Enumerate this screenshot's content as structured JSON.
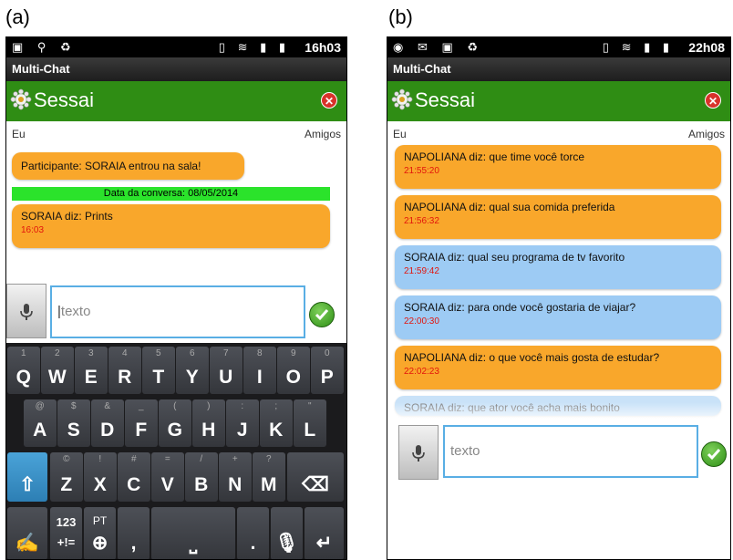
{
  "labels": {
    "a": "(a)",
    "b": "(b)"
  },
  "screen_a": {
    "status_time": "16h03",
    "app_title": "Multi-Chat",
    "brand": "Sessai",
    "col_left": "Eu",
    "col_right": "Amigos",
    "msg_join": "Participante: SORAIA entrou na sala!",
    "date_bar": "Data da conversa: 08/05/2014",
    "msg_text": "SORAIA diz: Prints",
    "msg_time": "16:03",
    "input_placeholder": "texto",
    "keyboard": {
      "row1": [
        {
          "k": "Q",
          "s": "1"
        },
        {
          "k": "W",
          "s": "2"
        },
        {
          "k": "E",
          "s": "3"
        },
        {
          "k": "R",
          "s": "4"
        },
        {
          "k": "T",
          "s": "5"
        },
        {
          "k": "Y",
          "s": "6"
        },
        {
          "k": "U",
          "s": "7"
        },
        {
          "k": "I",
          "s": "8"
        },
        {
          "k": "O",
          "s": "9"
        },
        {
          "k": "P",
          "s": "0"
        }
      ],
      "row2": [
        {
          "k": "A",
          "s": "@"
        },
        {
          "k": "S",
          "s": "$"
        },
        {
          "k": "D",
          "s": "&"
        },
        {
          "k": "F",
          "s": "_"
        },
        {
          "k": "G",
          "s": "("
        },
        {
          "k": "H",
          "s": ")"
        },
        {
          "k": "J",
          "s": ":"
        },
        {
          "k": "K",
          "s": ";"
        },
        {
          "k": "L",
          "s": "\""
        }
      ],
      "row3": [
        {
          "k": "Z",
          "s": "©"
        },
        {
          "k": "X",
          "s": "!"
        },
        {
          "k": "C",
          "s": "#"
        },
        {
          "k": "V",
          "s": "="
        },
        {
          "k": "B",
          "s": "/"
        },
        {
          "k": "N",
          "s": "+"
        },
        {
          "k": "M",
          "s": "?"
        }
      ],
      "sym_key": "123\n+!=",
      "lang_key": "PT"
    }
  },
  "screen_b": {
    "status_time": "22h08",
    "app_title": "Multi-Chat",
    "brand": "Sessai",
    "col_left": "Eu",
    "col_right": "Amigos",
    "messages": [
      {
        "text": "NAPOLIANA diz: que time você torce",
        "time": "21:55:20",
        "color": "orange"
      },
      {
        "text": "NAPOLIANA diz: qual sua comida preferida",
        "time": "21:56:32",
        "color": "orange"
      },
      {
        "text": "SORAIA diz: qual seu programa de tv favorito",
        "time": "21:59:42",
        "color": "blue"
      },
      {
        "text": "SORAIA diz: para onde você gostaria de viajar?",
        "time": "22:00:30",
        "color": "blue"
      },
      {
        "text": "NAPOLIANA diz: o que você mais gosta de estudar?",
        "time": "22:02:23",
        "color": "orange"
      },
      {
        "text": "SORAIA diz: que ator você acha mais bonito",
        "time": "",
        "color": "blue"
      }
    ],
    "input_placeholder": "texto"
  },
  "colors": {
    "green_header": "#2f8d14",
    "orange_bubble": "#f9a72b",
    "blue_bubble": "#9dcbf4",
    "timestamp": "#e2150c",
    "date_bar": "#2be32b"
  }
}
